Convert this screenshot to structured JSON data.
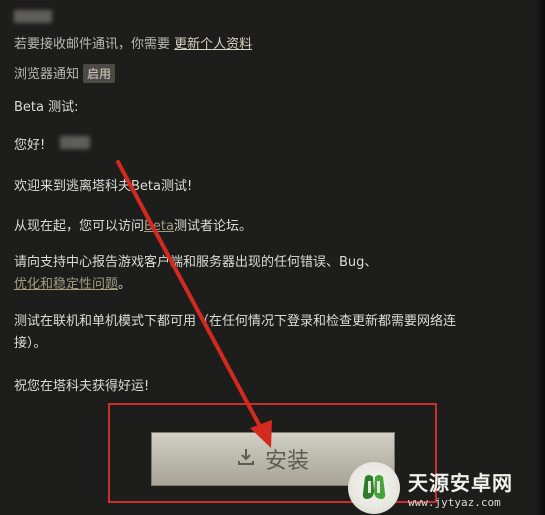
{
  "notification_settings": {
    "email_notice": "若要接收邮件通讯，你需要",
    "update_profile_link": "更新个人资料",
    "browser_notice_label": "浏览器通知",
    "enable_button": "启用"
  },
  "message": {
    "subject": "Beta 测试:",
    "greeting": "您好!",
    "welcome": "欢迎来到逃离塔科夫Beta测试!",
    "forum_prefix": "从现在起，您可以访问",
    "forum_link": "Beta",
    "forum_suffix": "测试者论坛。",
    "report_text": "请向支持中心报告游戏客户端和服务器出现的任何错误、Bug、",
    "report_link": "优化和稳定性问题",
    "report_end": "。",
    "network_note": "测试在联机和单机模式下都可用（在任何情况下登录和检查更新都需要网络连接）。",
    "good_luck": "祝您在塔科夫获得好运!"
  },
  "install_button": {
    "label": "安装",
    "icon": "download-icon"
  },
  "watermark": {
    "name": "天源安卓网",
    "url": "www.jytyaz.com"
  },
  "colors": {
    "panel_bg": "#1d1d1c",
    "highlight_red": "#c9302a",
    "button_bg": "#c5c2b5"
  }
}
